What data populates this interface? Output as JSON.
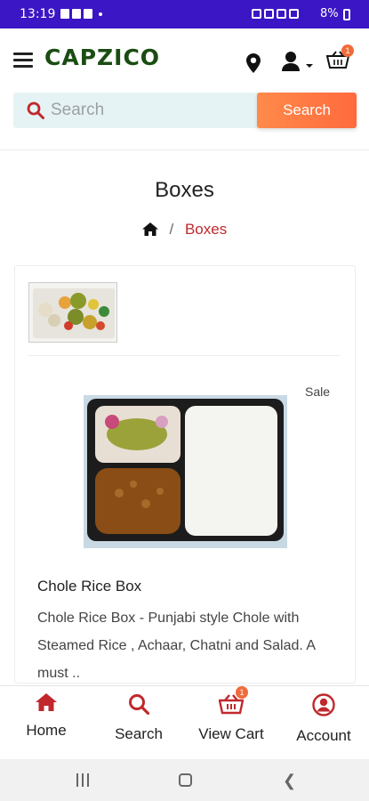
{
  "status_bar": {
    "time": "13:19",
    "battery": "8%"
  },
  "header": {
    "logo": "CAPZICO",
    "cart_count": "1"
  },
  "search": {
    "placeholder": "Search",
    "button_label": "Search"
  },
  "page": {
    "title": "Boxes",
    "breadcrumb": "Boxes",
    "breadcrumb_separator": "/"
  },
  "product": {
    "badge": "Sale",
    "name": "Chole Rice Box",
    "description": "Chole Rice Box - Punjabi style Chole with Steamed Rice , Achaar, Chatni and Salad. A must .."
  },
  "bottom_nav": {
    "items": [
      {
        "label": "Home",
        "icon": "home-icon"
      },
      {
        "label": "Search",
        "icon": "search-icon"
      },
      {
        "label": "View Cart",
        "icon": "cart-icon",
        "badge": "1"
      },
      {
        "label": "Account",
        "icon": "account-icon"
      }
    ]
  },
  "colors": {
    "status_bar": "#3b16c4",
    "brand": "#1a4d12",
    "accent": "#c0282d",
    "search_button": "#ff6a3d"
  }
}
